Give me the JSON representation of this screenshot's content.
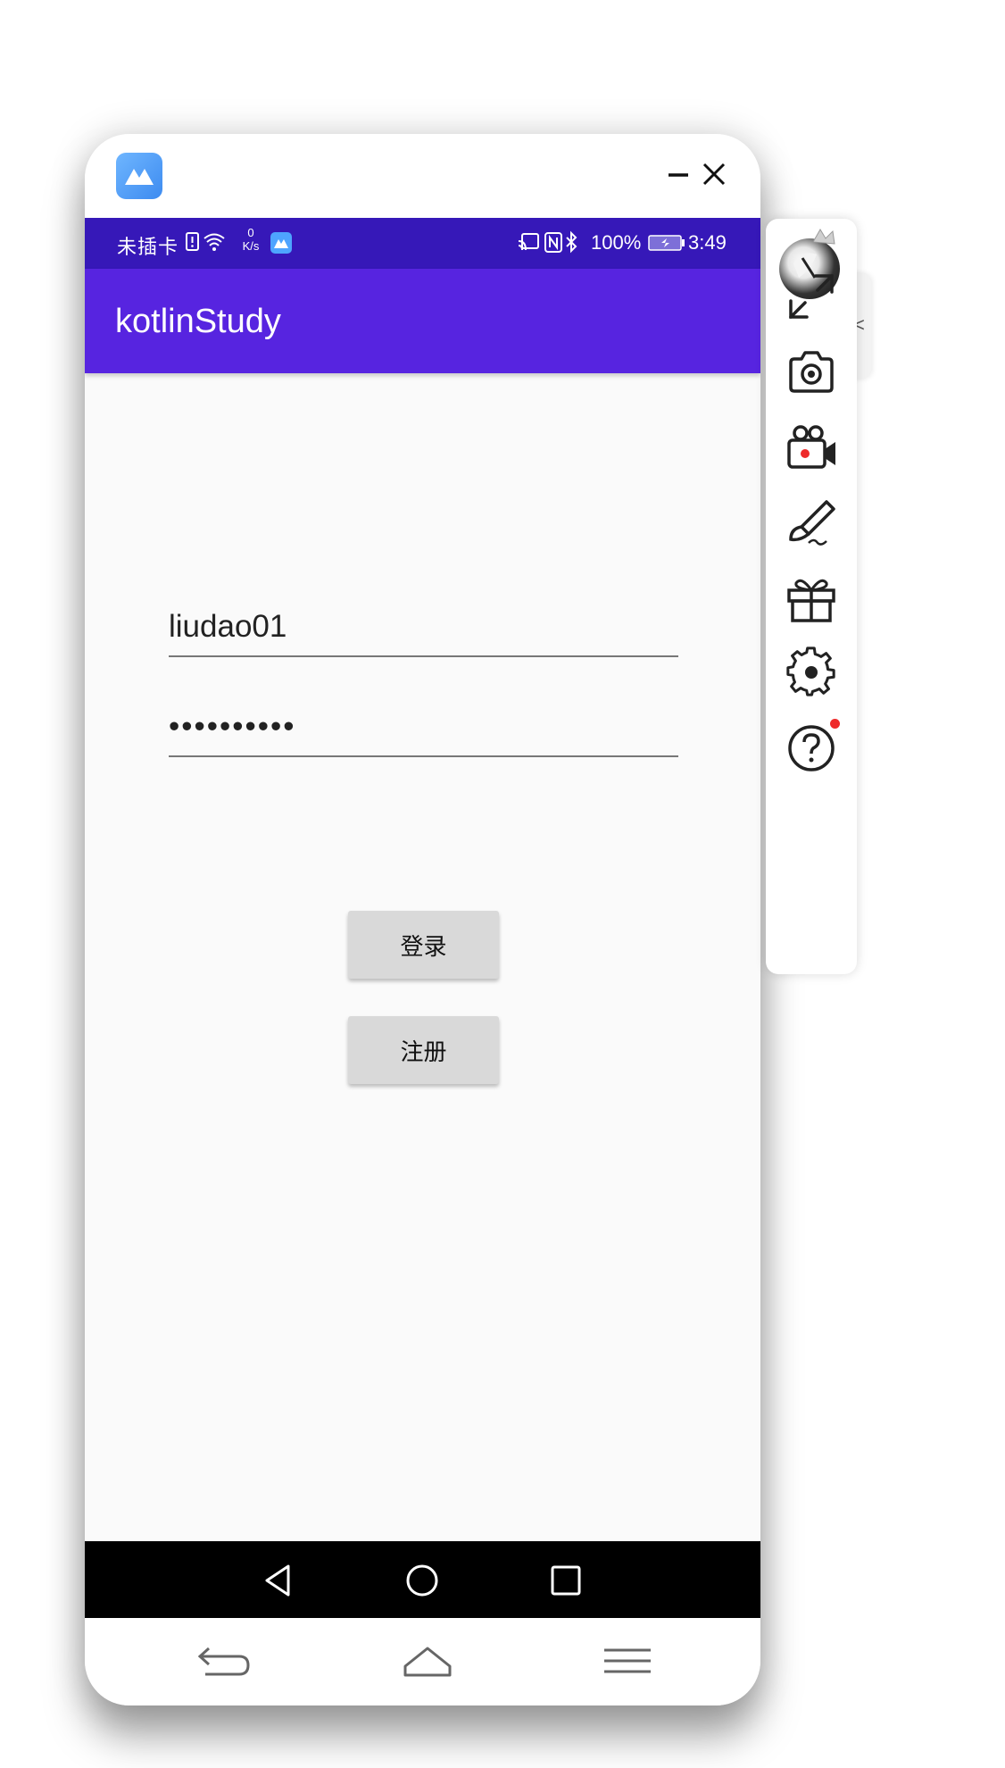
{
  "window": {
    "logo_icon": "mirror-app-logo-icon",
    "minimize_icon": "minimize-icon",
    "close_icon": "close-icon"
  },
  "status_bar": {
    "carrier": "未插卡",
    "net_speed_value": "0",
    "net_speed_unit": "K/s",
    "battery": "100%",
    "time": "3:49",
    "icons": [
      "sim-alert-icon",
      "wifi-icon",
      "app-notification-icon",
      "cast-icon",
      "nfc-icon",
      "bluetooth-icon",
      "battery-icon"
    ]
  },
  "app": {
    "title": "kotlinStudy",
    "colors": {
      "status_bar": "#3618b8",
      "app_bar": "#5724e0",
      "background": "#fafafa"
    },
    "username_value": "liudao01",
    "password_value": "••••••••••",
    "login_label": "登录",
    "register_label": "注册"
  },
  "android_nav": [
    "back-triangle-icon",
    "home-circle-icon",
    "recents-square-icon"
  ],
  "mirror_nav": [
    "return-icon",
    "home-icon",
    "menu-icon"
  ],
  "side_toolbar": {
    "collapse_glyph": "<",
    "tools": [
      "avatar",
      "fullscreen-icon",
      "screenshot-camera-icon",
      "screen-record-icon",
      "brush-annotate-icon",
      "gift-icon",
      "settings-gear-icon",
      "help-icon"
    ],
    "gift_has_notification": true
  }
}
